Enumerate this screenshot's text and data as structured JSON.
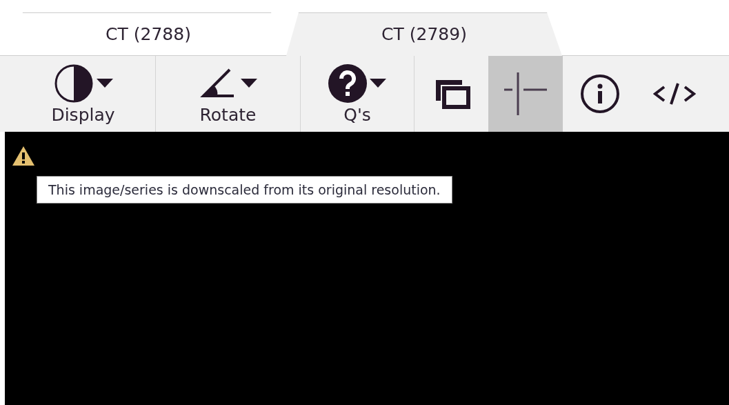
{
  "tabs": [
    {
      "label": "CT (2788)",
      "selected": false
    },
    {
      "label": "CT (2789)",
      "selected": true
    }
  ],
  "toolbar": [
    {
      "kind": "contrast",
      "label": "Display",
      "dropdown": true,
      "selected": false
    },
    {
      "kind": "angle",
      "label": "Rotate",
      "dropdown": true,
      "selected": false
    },
    {
      "kind": "help",
      "label": "Q's",
      "dropdown": true,
      "selected": false
    },
    {
      "kind": "layers",
      "dropdown": false,
      "selected": false
    },
    {
      "kind": "crosshair",
      "dropdown": false,
      "selected": true
    },
    {
      "kind": "info",
      "dropdown": false,
      "selected": false
    },
    {
      "kind": "code",
      "dropdown": false,
      "selected": false
    }
  ],
  "viewer": {
    "warning": true,
    "tooltip": "This image/series is downscaled from its original resolution."
  }
}
